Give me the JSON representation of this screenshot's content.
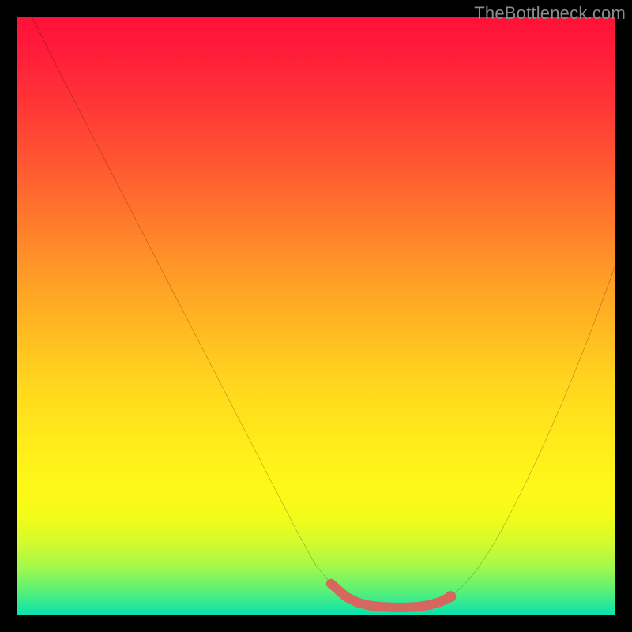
{
  "watermark": {
    "text": "TheBottleneck.com"
  },
  "colors": {
    "background": "#000000",
    "curve_stroke": "#000000",
    "marker_stroke": "#d6675f",
    "marker_fill": "#d6675f",
    "watermark_text": "#8b8b8b",
    "gradient_stops": [
      "#ff1038",
      "#ff3436",
      "#ff7a2c",
      "#ffbf21",
      "#fff419",
      "#d2fb2d",
      "#59f176",
      "#0ce1b0"
    ]
  },
  "chart_data": {
    "type": "line",
    "title": "",
    "xlabel": "",
    "ylabel": "",
    "xlim": [
      0,
      100
    ],
    "ylim": [
      0,
      100
    ],
    "grid": false,
    "legend": false,
    "series": [
      {
        "name": "bottleneck-curve",
        "x": [
          2.5,
          5,
          8,
          11,
          14,
          17,
          20,
          23,
          26,
          29,
          32,
          35,
          38,
          41,
          44,
          47,
          50,
          52.5,
          55,
          57,
          59,
          61,
          63,
          65,
          67,
          69,
          71,
          73,
          75,
          77,
          79,
          81,
          83,
          85,
          87,
          89,
          91,
          93,
          95,
          97,
          99,
          100
        ],
        "y": [
          100,
          95,
          89,
          83.2,
          77.4,
          71.6,
          65.8,
          60,
          54.2,
          48.4,
          42.6,
          36.8,
          31,
          25.2,
          19.4,
          13.6,
          8.2,
          5.2,
          3,
          2,
          1.5,
          1.3,
          1.2,
          1.2,
          1.3,
          1.6,
          2.2,
          3.4,
          5.2,
          7.6,
          10.6,
          14,
          17.8,
          21.8,
          26,
          30.4,
          35,
          39.8,
          44.8,
          50,
          55.4,
          58.2
        ]
      }
    ],
    "marker_region": {
      "name": "optimal-zone",
      "x": [
        52.5,
        55,
        57,
        59,
        61,
        63,
        65,
        67,
        69,
        71,
        72.5
      ],
      "y": [
        5.2,
        3,
        2,
        1.5,
        1.3,
        1.2,
        1.2,
        1.3,
        1.6,
        2.2,
        3.0
      ]
    }
  }
}
